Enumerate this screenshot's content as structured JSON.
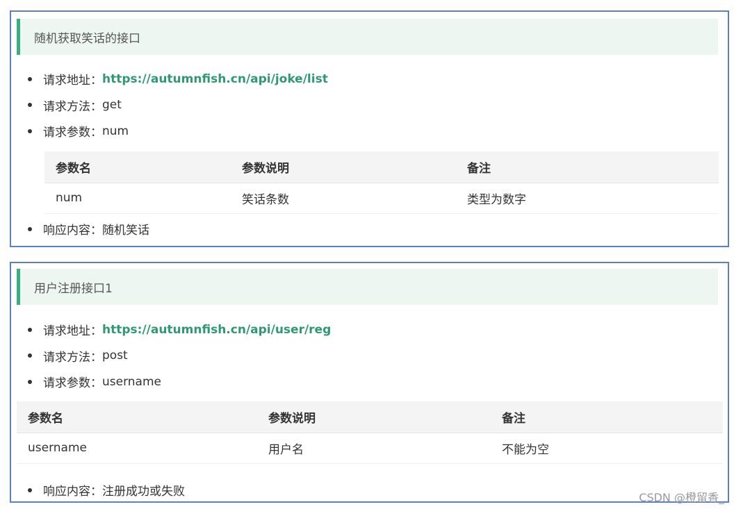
{
  "sections": [
    {
      "title": "随机获取笑话的接口",
      "url_label": "请求地址：",
      "url": "https://autumnfish.cn/api/joke/list",
      "method_label": "请求方法：",
      "method": "get",
      "params_label": "请求参数：",
      "params": "num",
      "table": {
        "headers": [
          "参数名",
          "参数说明",
          "备注"
        ],
        "rows": [
          [
            "num",
            "笑话条数",
            "类型为数字"
          ]
        ]
      },
      "response_label": "响应内容：",
      "response": "随机笑话"
    },
    {
      "title": "用户注册接口1",
      "url_label": "请求地址：",
      "url": "https://autumnfish.cn/api/user/reg",
      "method_label": "请求方法：",
      "method": "post",
      "params_label": "请求参数：",
      "params": "username",
      "table": {
        "headers": [
          "参数名",
          "参数说明",
          "备注"
        ],
        "rows": [
          [
            "username",
            "用户名",
            "不能为空"
          ]
        ]
      },
      "response_label": "响应内容：",
      "response": "注册成功或失败"
    }
  ],
  "watermark": "CSDN @橙留香_",
  "colors": {
    "accent": "#3cac83",
    "link": "#2f9a72",
    "border": "#5b7fc6"
  }
}
